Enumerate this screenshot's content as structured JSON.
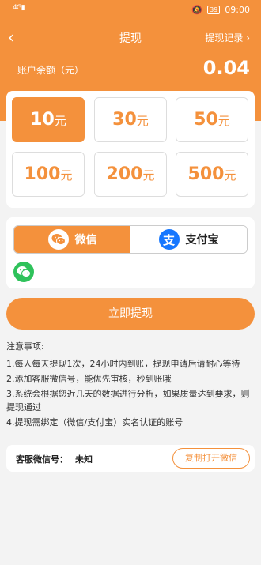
{
  "status_bar": {
    "signal": "4G",
    "battery": "39",
    "time": "09:00"
  },
  "nav": {
    "back_icon": "chevron-left",
    "title": "提现",
    "record_link": "提现记录 ›"
  },
  "balance": {
    "label": "账户余额（元）",
    "value": "0.04"
  },
  "amounts": {
    "unit": "元",
    "options": [
      {
        "value": "10",
        "selected": true
      },
      {
        "value": "30",
        "selected": false
      },
      {
        "value": "50",
        "selected": false
      },
      {
        "value": "100",
        "selected": false
      },
      {
        "value": "200",
        "selected": false
      },
      {
        "value": "500",
        "selected": false
      }
    ]
  },
  "payment": {
    "wechat_label": "微信",
    "alipay_label": "支付宝",
    "alipay_glyph": "支",
    "selected": "wechat"
  },
  "submit_label": "立即提现",
  "notes": {
    "title": "注意事项:",
    "items": [
      "1.每人每天提现1次，24小时内到账，提现申请后请耐心等待",
      "2.添加客服微信号，能优先审核，秒到账哦",
      "3.系统会根据您近几天的数据进行分析，如果质量达到要求，则提现通过",
      "4.提现需绑定（微信/支付宝）实名认证的账号"
    ]
  },
  "contact": {
    "label": "客服微信号：",
    "value": "未知",
    "copy_label": "复制打开微信"
  },
  "colors": {
    "accent": "#f4913c",
    "wechat_green": "#2fc25b",
    "alipay_blue": "#1677ff"
  }
}
